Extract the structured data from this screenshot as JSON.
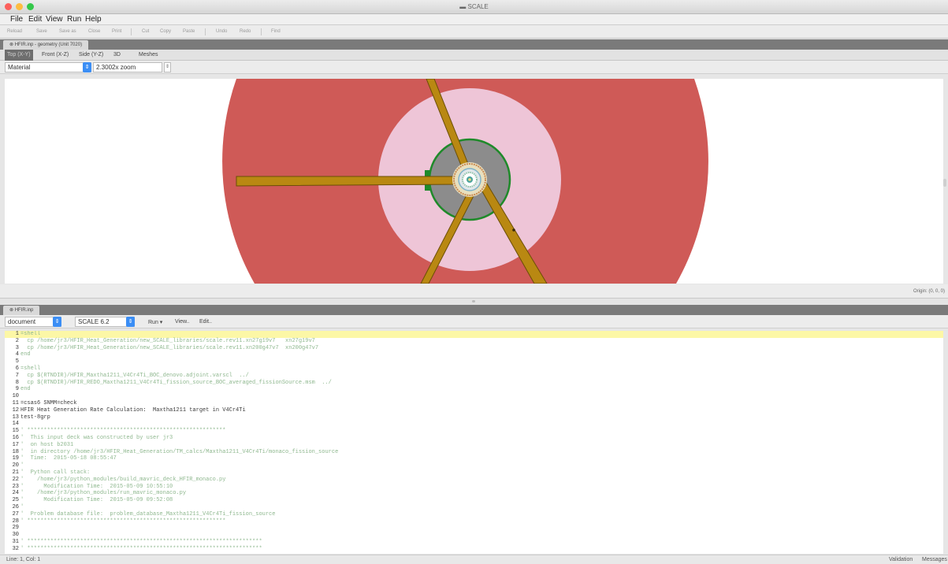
{
  "window": {
    "title": "SCALE"
  },
  "menu": [
    "File",
    "Edit",
    "View",
    "Run",
    "Help"
  ],
  "toolbar": [
    "Reload",
    "Save",
    "Save as",
    "Close",
    "Print",
    "Cut",
    "Copy",
    "Paste",
    "Undo",
    "Redo",
    "Find"
  ],
  "geometry_tab": {
    "label": "HFIR.inp - geometry (Unit 7020)"
  },
  "view_tabs": [
    "Top (X-Y)",
    "Front (X-Z)",
    "Side (Y-Z)",
    "3D",
    "Meshes"
  ],
  "color_mode": {
    "value": "Material"
  },
  "zoom": {
    "value": "2.3002x zoom"
  },
  "geometry_status": {
    "origin": "Origin: (0, 0, 0)"
  },
  "colors": {
    "outer": "#cf5a57",
    "reflector": "#eec5d7",
    "vessel": "#8c8c8c",
    "ring": "#1f8a2a",
    "beam": "#b98812"
  },
  "doc_tab": {
    "label": "HFIR.inp"
  },
  "doc_toolbar": {
    "doc_type": "document",
    "version": "SCALE 6.2",
    "run": "Run",
    "view": "View..",
    "edit": "Edit.."
  },
  "editor": {
    "lines": [
      {
        "n": "1",
        "t": "=shell"
      },
      {
        "n": "2",
        "t": "  cp /home/jr3/HFIR_Heat_Generation/new_SCALE_libraries/scale.rev11.xn27g19v7   xn27g19v7"
      },
      {
        "n": "3",
        "t": "  cp /home/jr3/HFIR_Heat_Generation/new_SCALE_libraries/scale.rev11.xn200g47v7  xn200g47v7"
      },
      {
        "n": "4",
        "t": "end"
      },
      {
        "n": "5",
        "t": ""
      },
      {
        "n": "6",
        "t": "=shell"
      },
      {
        "n": "7",
        "t": "  cp $(RTNDIR)/HFIR_Maxtha1211_V4Cr4Ti_BOC_denovo.adjoint.varscl  ../"
      },
      {
        "n": "8",
        "t": "  cp $(RTNDIR)/HFIR_REDO_Maxtha1211_V4Cr4Ti_fission_source_BOC_averaged_fissionSource.msm  ../"
      },
      {
        "n": "9",
        "t": "end"
      },
      {
        "n": "10",
        "t": ""
      },
      {
        "n": "11",
        "t": "=csas6 SNMM=check"
      },
      {
        "n": "12",
        "t": "HFIR Heat Generation Rate Calculation:  Maxtha1211 target in V4Cr4Ti"
      },
      {
        "n": "13",
        "t": "test-8grp"
      },
      {
        "n": "14",
        "t": ""
      },
      {
        "n": "15",
        "t": "' ************************************************************"
      },
      {
        "n": "16",
        "t": "'  This input deck was constructed by user jr3"
      },
      {
        "n": "17",
        "t": "'  on host b2031"
      },
      {
        "n": "18",
        "t": "'  in directory /home/jr3/HFIR_Heat_Generation/TM_calcs/Maxtha1211_V4Cr4Ti/monaco_fission_source"
      },
      {
        "n": "19",
        "t": "'  Time:  2015-05-18 08:55:47"
      },
      {
        "n": "20",
        "t": "'"
      },
      {
        "n": "21",
        "t": "'  Python call stack:"
      },
      {
        "n": "22",
        "t": "'    /home/jr3/python_modules/build_mavric_deck_HFIR_monaco.py"
      },
      {
        "n": "23",
        "t": "'      Modification Time:  2015-05-09 10:55:10"
      },
      {
        "n": "24",
        "t": "'    /home/jr3/python_modules/run_mavric_monaco.py"
      },
      {
        "n": "25",
        "t": "'      Modification Time:  2015-05-09 09:52:08"
      },
      {
        "n": "26",
        "t": "'"
      },
      {
        "n": "27",
        "t": "'  Problem database file:  problem_database_Maxtha1211_V4Cr4Ti_fission_source"
      },
      {
        "n": "28",
        "t": "' ************************************************************"
      },
      {
        "n": "29",
        "t": ""
      },
      {
        "n": "30",
        "t": ""
      },
      {
        "n": "31",
        "t": "' ***********************************************************************"
      },
      {
        "n": "32",
        "t": "' ***********************************************************************"
      }
    ]
  },
  "status": {
    "cursor": "Line: 1, Col: 1",
    "validation": "Validation",
    "messages": "Messages"
  }
}
